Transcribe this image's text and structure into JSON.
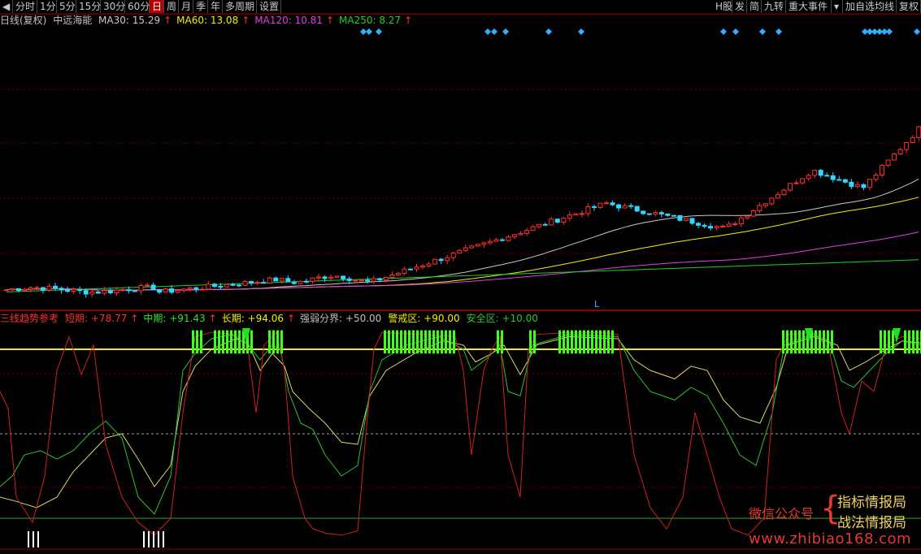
{
  "toolbar": {
    "left_items": [
      "分时",
      "1分",
      "5分",
      "15分",
      "30分",
      "60分",
      "日",
      "周",
      "月",
      "季",
      "年",
      "多周期",
      "设置"
    ],
    "active": "日",
    "right_items": [
      "H股",
      "发",
      "简",
      "九转",
      "重大事件",
      "加自选",
      "均线",
      "复权"
    ]
  },
  "price_panel": {
    "period_label": "日线(复权)",
    "stock_name": "中远海能",
    "mas": [
      {
        "label": "MA30: 15.29",
        "color": "#c8c8c8"
      },
      {
        "label": "MA60: 13.08",
        "color": "#f0f000"
      },
      {
        "label": "MA120: 10.81",
        "color": "#e040e0"
      },
      {
        "label": "MA250: 8.27",
        "color": "#20d020"
      }
    ],
    "low_marker": "L"
  },
  "indicator_panel": {
    "title": "三线趋势参考",
    "items": [
      {
        "label": "短期: +78.77",
        "color": "#ff3030"
      },
      {
        "label": "中期: +91.43",
        "color": "#30e030"
      },
      {
        "label": "长期: +94.06",
        "color": "#f0f000"
      },
      {
        "label": "强弱分界: +50.00",
        "color": "#c0c0c0"
      },
      {
        "label": "警戒区: +90.00",
        "color": "#f0f000"
      },
      {
        "label": "安全区: +10.00",
        "color": "#30c030"
      }
    ],
    "levels": {
      "warning": 90,
      "divider": 50,
      "safe": 10
    }
  },
  "colors": {
    "up": "#ff3030",
    "down": "#30d8ff",
    "short_line": "#d02020",
    "mid_line": "#30c030",
    "long_line": "#d8d870",
    "warning_line": "#f0f000",
    "signal_bar": "#40ff20",
    "arrow": "#20e020"
  },
  "watermark": {
    "wechat": "微信公众号",
    "brand1": "指标情报局",
    "brand2": "战法情报局",
    "url": "www.zhibiao168.com"
  }
}
